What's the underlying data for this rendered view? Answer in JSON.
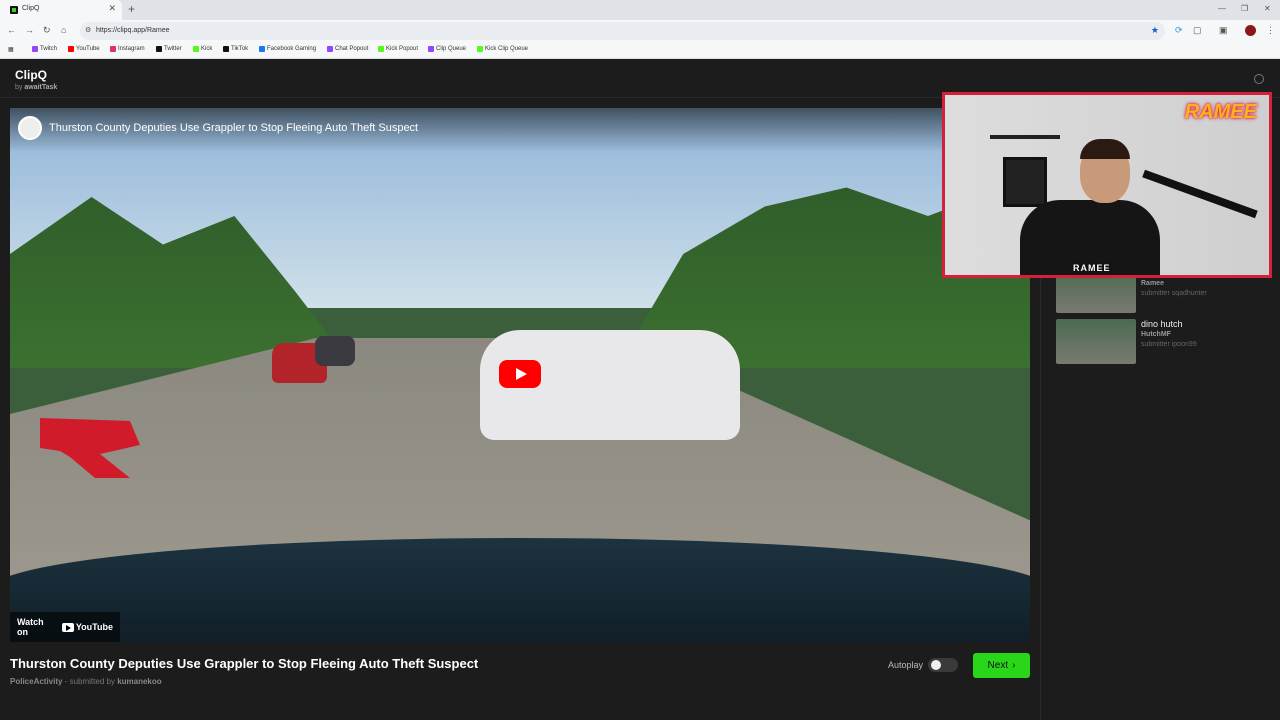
{
  "browser": {
    "tab_title": "ClipQ",
    "close_glyph": "✕",
    "newtab_glyph": "+",
    "url": "https://clipq.app/Ramee",
    "minimize_glyph": "—",
    "restore_glyph": "❐",
    "close_window_glyph": "✕",
    "back_glyph": "←",
    "forward_glyph": "→",
    "reload_glyph": "↻",
    "home_glyph": "⌂",
    "star_glyph": "★",
    "bookmarks": [
      {
        "label": "Twitch",
        "color": "#9146ff"
      },
      {
        "label": "YouTube",
        "color": "#ff0000"
      },
      {
        "label": "Instagram",
        "color": "#e1306c"
      },
      {
        "label": "Twitter",
        "color": "#111111"
      },
      {
        "label": "Kick",
        "color": "#53fc18"
      },
      {
        "label": "TikTok",
        "color": "#111111"
      },
      {
        "label": "Facebook Gaming",
        "color": "#1877f2"
      },
      {
        "label": "Chat Popout",
        "color": "#9146ff"
      },
      {
        "label": "Kick Popout",
        "color": "#53fc18"
      },
      {
        "label": "Clip Queue",
        "color": "#9146ff"
      },
      {
        "label": "Kick Clip Queue",
        "color": "#53fc18"
      }
    ]
  },
  "app": {
    "logo": "ClipQ",
    "by_prefix": "by",
    "by_author": "awaitTask",
    "accent_color": "#2ad61a"
  },
  "player": {
    "overlay_title": "Thurston County Deputies Use Grappler to Stop Fleeing Auto Theft Suspect",
    "watch_on": "Watch on",
    "youtube_label": "YouTube"
  },
  "clip": {
    "title": "Thurston County Deputies Use Grappler to Stop Fleeing Auto Theft Suspect",
    "channel": "PoliceActivity",
    "submitted_by_label": "- submitted by",
    "submitter": "kumanekoo"
  },
  "controls": {
    "autoplay_label": "Autoplay",
    "autoplay_on": false,
    "next_label": "Next",
    "next_glyph": "›"
  },
  "queue": [
    {
      "title": "",
      "channel": "Ramee",
      "submitter": "submitter sqadhunter"
    },
    {
      "title": "dino hutch",
      "channel": "HutchMF",
      "submitter": "submitter ipoon99"
    }
  ],
  "webcam": {
    "brand": "RAMEE",
    "brand_small": "RAMEE",
    "border_color": "#d81f3a"
  }
}
